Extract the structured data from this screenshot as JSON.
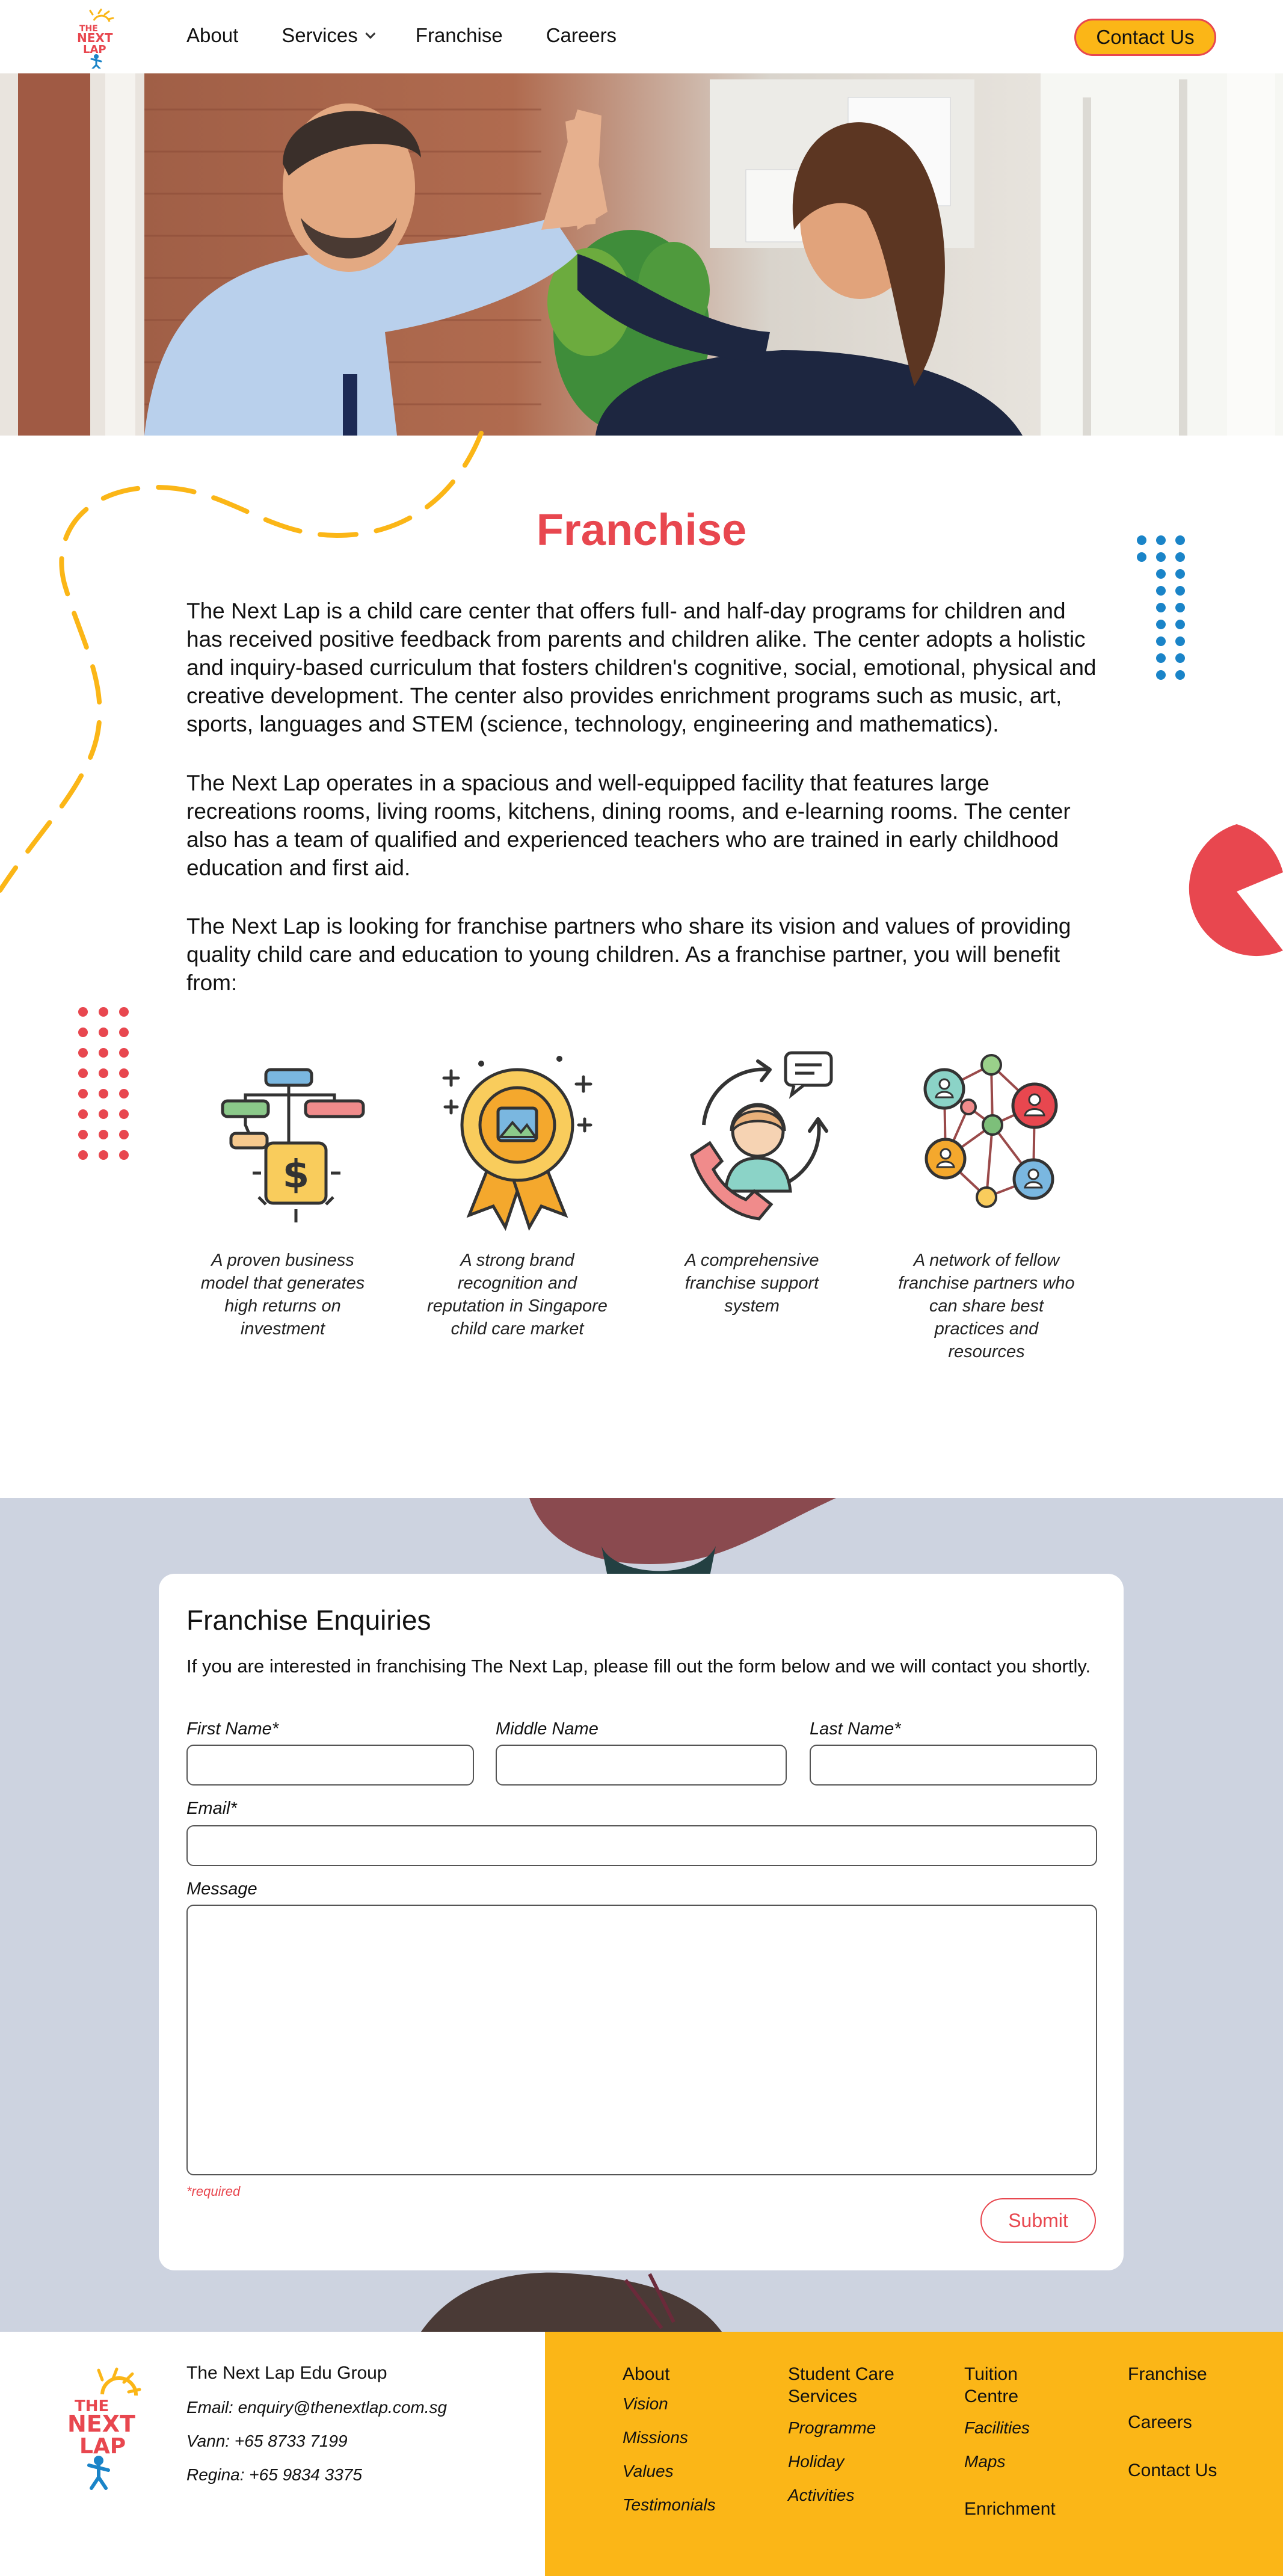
{
  "brand": {
    "logo_line1": "THE",
    "logo_line2": "NEXT",
    "logo_line3": "LAP"
  },
  "nav": {
    "items": [
      "About",
      "Services",
      "Franchise",
      "Careers"
    ],
    "contact_label": "Contact Us"
  },
  "main": {
    "title": "Franchise",
    "paragraphs": [
      "The Next Lap is a child care center that offers full- and half-day programs for children and has received positive feedback from parents and children alike. The center adopts a holistic and inquiry-based curriculum that fosters children's cognitive, social, emotional, physical and creative development. The center also provides enrichment programs such as music, art, sports, languages and STEM (science, technology, engineering and mathematics).",
      "The Next Lap operates in a spacious and well-equipped facility that features large recreations rooms, living rooms, kitchens, dining rooms, and e-learning rooms. The center also has a team of qualified and experienced teachers who are trained in early childhood education and first aid.",
      "The Next Lap is looking for franchise partners who share its vision and values of providing quality child care and education to young children. As a franchise partner, you will benefit from:"
    ],
    "features": [
      {
        "icon": "business-model-icon",
        "text": "A proven business model that generates high returns on investment"
      },
      {
        "icon": "brand-badge-icon",
        "text": "A strong brand recognition and reputation in Singapore child care market"
      },
      {
        "icon": "support-agent-icon",
        "text": "A comprehensive franchise support system"
      },
      {
        "icon": "network-icon",
        "text": "A network of fellow franchise partners who can share best practices and resources"
      }
    ]
  },
  "form": {
    "title": "Franchise Enquiries",
    "intro": "If you are interested in franchising The Next Lap, please fill out the form below and we will contact you shortly.",
    "first_name_label": "First Name*",
    "middle_name_label": "Middle Name",
    "last_name_label": "Last Name*",
    "email_label": "Email*",
    "message_label": "Message",
    "required_note": "*required",
    "submit_label": "Submit",
    "first_name_value": "",
    "middle_name_value": "",
    "last_name_value": "",
    "email_value": "",
    "message_value": ""
  },
  "footer": {
    "company": "The Next Lap Edu Group",
    "email": "Email: enquiry@thenextlap.com.sg",
    "vann": "Vann: +65 8733 7199",
    "regina": "Regina: +65 9834 3375",
    "about": {
      "heading": "About",
      "links": [
        "Vision",
        "Missions",
        "Values",
        "Testimonials"
      ]
    },
    "student_care": {
      "heading_line1": "Student Care",
      "heading_line2": "Services",
      "links": [
        "Programme",
        "Holiday",
        "Activities"
      ]
    },
    "tuition": {
      "heading_line1": "Tuition",
      "heading_line2": "Centre",
      "links": [
        "Facilities",
        "Maps"
      ],
      "enrichment": "Enrichment"
    },
    "right_links": [
      "Franchise",
      "Careers",
      "Contact Us"
    ]
  },
  "colors": {
    "accent_red": "#e8474f",
    "accent_yellow": "#fbb617",
    "accent_blue": "#1a84c8",
    "form_bg": "#cdd3e0"
  }
}
